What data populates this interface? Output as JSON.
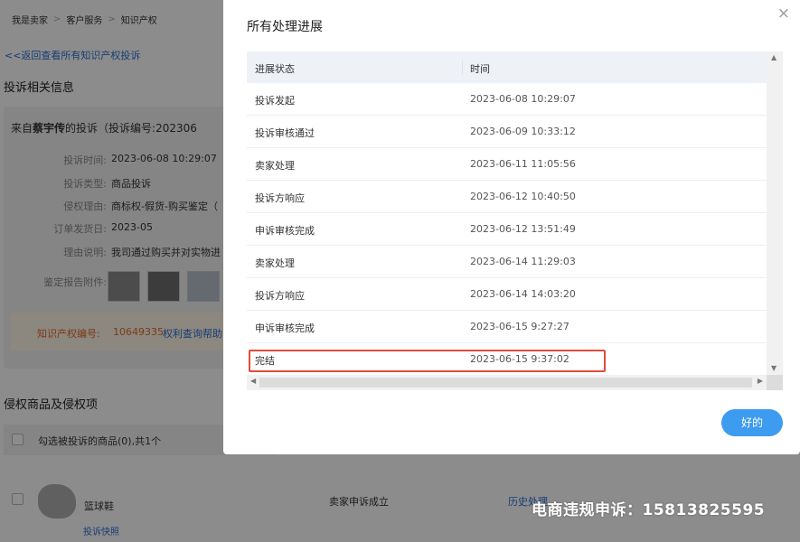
{
  "background": {
    "breadcrumb": [
      "我是卖家",
      "客户服务",
      "知识产权"
    ],
    "back_link": "<<返回查看所有知识产权投诉",
    "complaint_info_title": "投诉相关信息",
    "card": {
      "head_prefix": "来自",
      "head_name": "蔡宇传",
      "head_suffix": "的投诉（投诉编号:202306",
      "rows": [
        {
          "label": "投诉时间:",
          "value": "2023-06-08 10:29:07"
        },
        {
          "label": "投诉类型:",
          "value": "商品投诉"
        },
        {
          "label": "侵权理由:",
          "value": "商标权-假货-购买鉴定（"
        },
        {
          "label": "订单发货日:",
          "value": "2023-05"
        },
        {
          "label": "理由说明:",
          "value": "我司通过购买并对实物进"
        }
      ],
      "report_label": "鉴定报告附件:"
    },
    "ip_label": "知识产权编号:",
    "ip_number": "10649335",
    "ip_link": "权利查询帮助",
    "infringing_title": "侵权商品及侵权项",
    "select_text": "勾选被投诉的商品(0),共1个",
    "product_name": "篮球鞋",
    "product_link": "投诉快照",
    "product_status": "卖家申诉成立",
    "product_history": "历史处理"
  },
  "modal": {
    "title": "所有处理进展",
    "close": "×",
    "columns": {
      "status": "进展状态",
      "time": "时间"
    },
    "rows": [
      {
        "status": "投诉发起",
        "time": "2023-06-08 10:29:07"
      },
      {
        "status": "投诉审核通过",
        "time": "2023-06-09 10:33:12"
      },
      {
        "status": "卖家处理",
        "time": "2023-06-11 11:05:56"
      },
      {
        "status": "投诉方响应",
        "time": "2023-06-12 10:40:50"
      },
      {
        "status": "申诉审核完成",
        "time": "2023-06-12 13:51:49"
      },
      {
        "status": "卖家处理",
        "time": "2023-06-14 11:29:03"
      },
      {
        "status": "投诉方响应",
        "time": "2023-06-14 14:03:20"
      },
      {
        "status": "申诉审核完成",
        "time": "2023-06-15 9:27:27"
      },
      {
        "status": "完结",
        "time": "2023-06-15 9:37:02"
      }
    ],
    "ok_label": "好的"
  },
  "watermark": "电商违规申诉：15813825595",
  "colors": {
    "accent": "#3d9bf0",
    "highlight": "#e34b3b",
    "link": "#2b6fd6",
    "ip_orange": "#e06b2a"
  }
}
